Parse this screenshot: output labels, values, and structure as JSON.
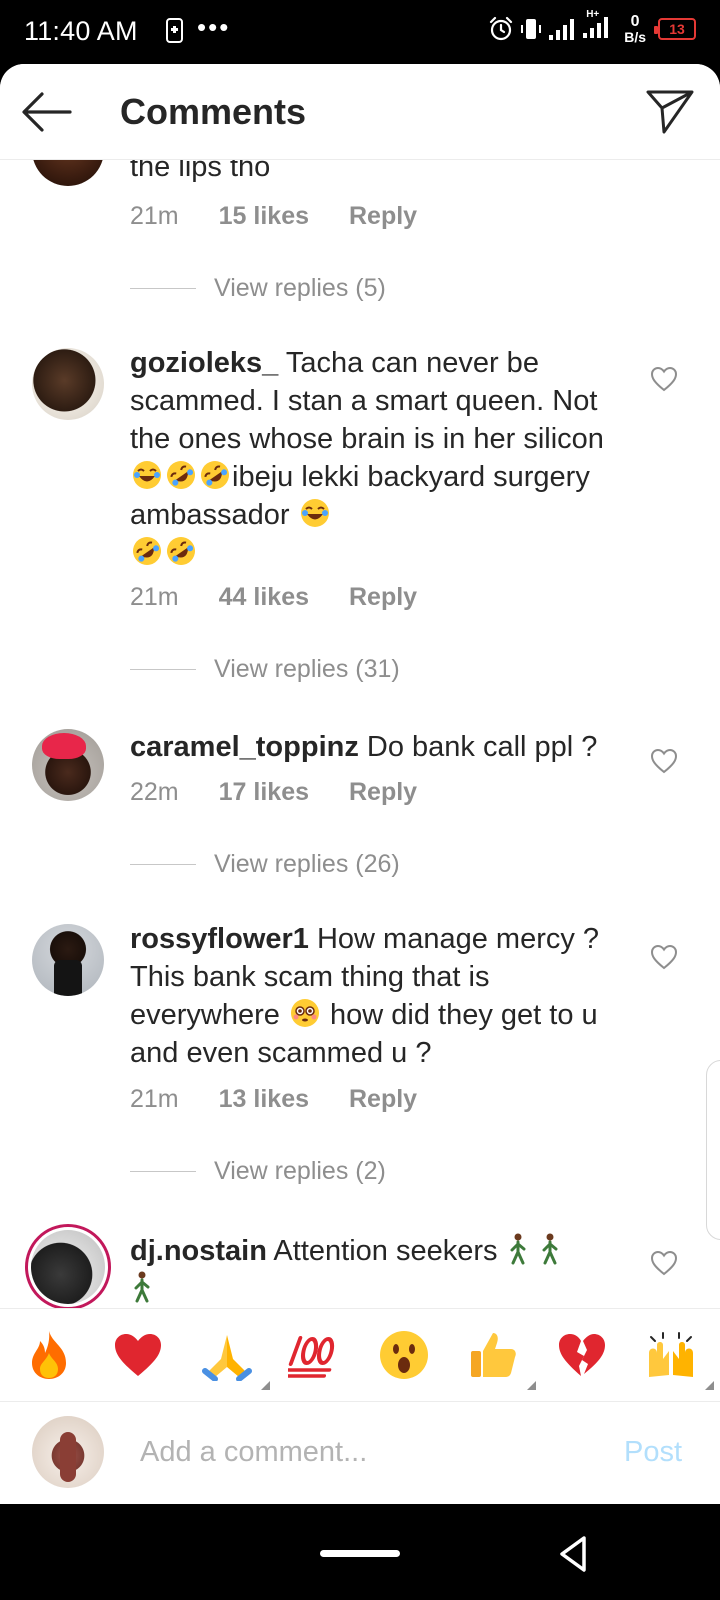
{
  "status_bar": {
    "time": "11:40 AM",
    "net_speed_value": "0",
    "net_speed_unit": "B/s",
    "battery": "13",
    "network_label": "H+"
  },
  "header": {
    "title": "Comments"
  },
  "comments": [
    {
      "username": "",
      "text": "the lips tho",
      "time": "21m",
      "likes": "15 likes",
      "reply": "Reply",
      "view_replies": "View replies (5)"
    },
    {
      "username": "gozioleks_",
      "text_parts": [
        "Tacha can never be scammed. I stan a smart queen. Not the ones whose brain is in her silicon ",
        "ibeju lekki backyard surgery ambassador "
      ],
      "emojis": [
        "face-with-tears-of-joy",
        "rolling-on-floor-laughing",
        "rolling-on-floor-laughing",
        "face-with-tears-of-joy",
        "rolling-on-floor-laughing",
        "rolling-on-floor-laughing"
      ],
      "time": "21m",
      "likes": "44 likes",
      "reply": "Reply",
      "view_replies": "View replies (31)"
    },
    {
      "username": "caramel_toppinz",
      "text": "Do bank call ppl ?",
      "time": "22m",
      "likes": "17 likes",
      "reply": "Reply",
      "view_replies": "View replies (26)"
    },
    {
      "username": "rossyflower1",
      "text_parts": [
        "How manage mercy ? This bank scam thing that is everywhere ",
        " how did they get to u and even scammed u ?"
      ],
      "emojis": [
        "flushed-face"
      ],
      "time": "21m",
      "likes": "13 likes",
      "reply": "Reply",
      "view_replies": "View replies (2)"
    },
    {
      "username": "dj.nostain",
      "text": "Attention seekers",
      "emojis": [
        "person-walking",
        "person-walking",
        "person-walking"
      ]
    }
  ],
  "emoji_bar": [
    "fire",
    "red-heart",
    "folded-hands",
    "hundred-points",
    "face-with-open-mouth",
    "thumbs-up",
    "broken-heart",
    "raising-hands"
  ],
  "input": {
    "placeholder": "Add a comment...",
    "post_label": "Post"
  },
  "colors": {
    "text": "#262626",
    "secondary": "#8e8e8e",
    "post_disabled": "#b2dffc",
    "battery": "#e53935"
  }
}
